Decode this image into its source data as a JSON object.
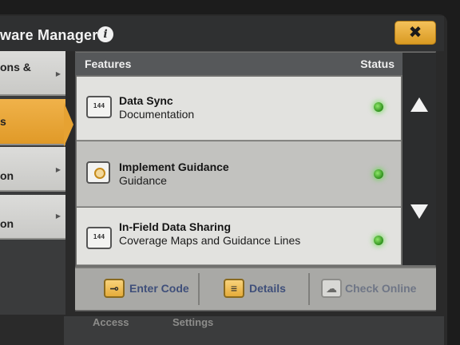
{
  "window": {
    "title": "ware Manager",
    "close_label": "✖"
  },
  "left_menu": {
    "items": [
      {
        "label": "ons &"
      },
      {
        "label": "s"
      },
      {
        "label": "on"
      },
      {
        "label": "on"
      }
    ]
  },
  "table": {
    "headers": {
      "features": "Features",
      "status": "Status"
    },
    "rows": [
      {
        "icon_text": "144",
        "title": "Data Sync",
        "subtitle": "Documentation",
        "status": "green"
      },
      {
        "icon_text": "",
        "title": "Implement Guidance",
        "subtitle": "Guidance",
        "status": "green"
      },
      {
        "icon_text": "144",
        "title": "In-Field Data Sharing",
        "subtitle": "Coverage Maps and Guidance Lines",
        "status": "green"
      }
    ]
  },
  "actions": {
    "enter_code": "Enter Code",
    "details": "Details",
    "check_online": "Check Online"
  },
  "bottom_strip": {
    "left": "Access",
    "right": "Settings"
  },
  "colors": {
    "accent": "#e6a232",
    "status_ok": "#3fb82a"
  }
}
